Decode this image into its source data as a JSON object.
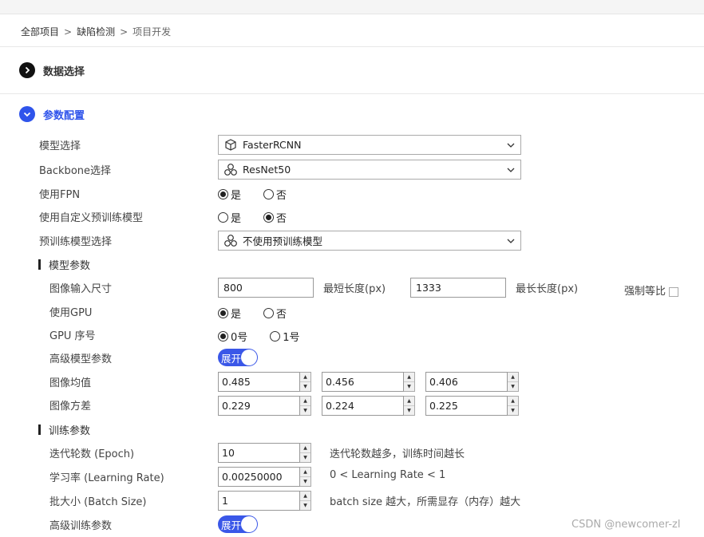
{
  "breadcrumb": {
    "items": [
      "全部项目",
      "缺陷检测",
      "项目开发"
    ],
    "sep": ">"
  },
  "sections": {
    "data_select": {
      "title": "数据选择"
    },
    "param_config": {
      "title": "参数配置"
    }
  },
  "form": {
    "model_select": {
      "label": "模型选择",
      "value": "FasterRCNN"
    },
    "backbone_select": {
      "label": "Backbone选择",
      "value": "ResNet50"
    },
    "use_fpn": {
      "label": "使用FPN",
      "options": [
        "是",
        "否"
      ],
      "selected": 0
    },
    "use_custom_pretrained": {
      "label": "使用自定义预训练模型",
      "options": [
        "是",
        "否"
      ],
      "selected": 1
    },
    "pretrained_select": {
      "label": "预训练模型选择",
      "value": "不使用预训练模型"
    },
    "model_params": {
      "title": "模型参数",
      "image_size": {
        "label": "图像输入尺寸",
        "min_value": "800",
        "min_label": "最短长度(px)",
        "max_value": "1333",
        "max_label": "最长长度(px)",
        "force_ratio_label": "强制等比"
      },
      "use_gpu": {
        "label": "使用GPU",
        "options": [
          "是",
          "否"
        ],
        "selected": 0
      },
      "gpu_index": {
        "label": "GPU 序号",
        "options": [
          "0号",
          "1号"
        ],
        "selected": 0
      },
      "advanced_model": {
        "label": "高级模型参数",
        "toggle_label": "展开"
      },
      "image_mean": {
        "label": "图像均值",
        "values": [
          "0.485",
          "0.456",
          "0.406"
        ]
      },
      "image_std": {
        "label": "图像方差",
        "values": [
          "0.229",
          "0.224",
          "0.225"
        ]
      }
    },
    "train_params": {
      "title": "训练参数",
      "epoch": {
        "label": "迭代轮数 (Epoch)",
        "value": "10",
        "hint": "迭代轮数越多，训练时间越长"
      },
      "lr": {
        "label": "学习率 (Learning Rate)",
        "value": "0.00250000",
        "hint": "0 < Learning Rate < 1"
      },
      "batch": {
        "label": "批大小 (Batch Size)",
        "value": "1",
        "hint": "batch size 越大，所需显存（内存）越大"
      },
      "advanced_train": {
        "label": "高级训练参数",
        "toggle_label": "展开"
      }
    }
  },
  "watermark": "CSDN @newcomer-zl",
  "colors": {
    "accent": "#2f54eb",
    "toggle": "#3a57e8"
  }
}
